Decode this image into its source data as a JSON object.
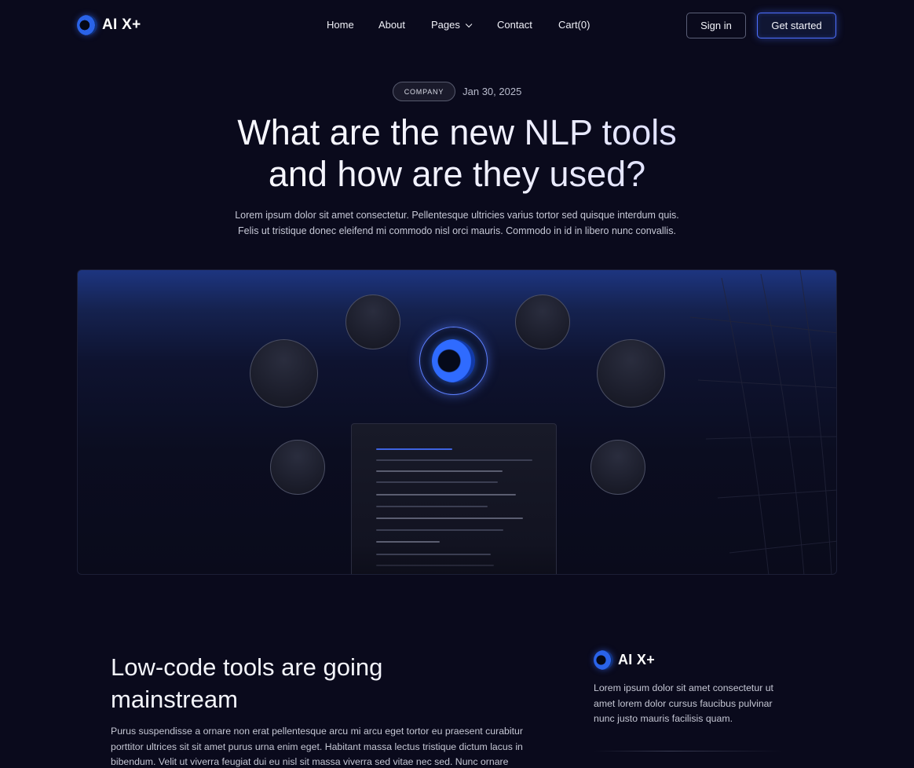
{
  "nav": {
    "logo_text": "AI X+",
    "items": [
      {
        "label": "Home"
      },
      {
        "label": "About"
      },
      {
        "label": "Pages"
      },
      {
        "label": "Contact"
      },
      {
        "label": "Cart(0)"
      }
    ],
    "signin_label": "Sign in",
    "cta_label": "Get started"
  },
  "post": {
    "category": "COMPANY",
    "date": "Jan 30, 2025",
    "title_line1": "What are the new NLP tools",
    "title_line2": "and how are they used?",
    "lead_line1": "Lorem ipsum dolor sit amet consectetur. Pellentesque ultricies varius tortor sed quisque interdum quis.",
    "lead_line2": "Felis ut tristique donec eleifend mi commodo nisl orci mauris. Commodo in id in libero nunc convallis."
  },
  "article": {
    "heading": "Low-code tools are going mainstream",
    "paragraph": "Purus suspendisse a ornare non erat pellentesque arcu mi arcu eget tortor eu praesent curabitur porttitor ultrices sit sit amet purus urna enim eget. Habitant massa lectus tristique dictum lacus in bibendum. Velit ut viverra feugiat dui eu nisl sit massa viverra sed vitae nec sed. Nunc ornare"
  },
  "sidebar": {
    "logo_text": "AI X+",
    "text": "Lorem ipsum dolor sit amet consectetur ut amet lorem dolor cursus faucibus pulvinar nunc justo mauris facilisis quam."
  },
  "colors": {
    "background": "#0a0a1c",
    "accent": "#4d6fff"
  },
  "icons": [
    "logo-icon",
    "chevron-down-icon"
  ]
}
